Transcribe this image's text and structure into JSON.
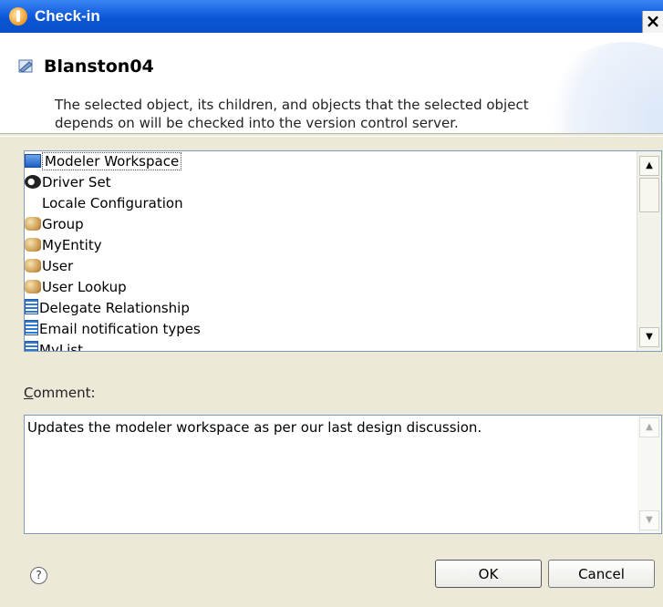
{
  "window": {
    "title": "Check-in",
    "close_label": "×"
  },
  "header": {
    "object_name": "Blanston04",
    "description_line1": "The selected object, its children, and objects that the selected object",
    "description_line2": "depends on will be checked into the version control server."
  },
  "list": {
    "items": [
      {
        "label": "Modeler Workspace",
        "icon": "workspace-icon"
      },
      {
        "label": "Driver Set",
        "icon": "driver-set-icon"
      },
      {
        "label": "Locale Configuration",
        "icon": "none"
      },
      {
        "label": "Group",
        "icon": "entity-icon"
      },
      {
        "label": "MyEntity",
        "icon": "entity-icon"
      },
      {
        "label": "User",
        "icon": "entity-icon"
      },
      {
        "label": "User Lookup",
        "icon": "entity-icon"
      },
      {
        "label": "Delegate Relationship",
        "icon": "list-icon"
      },
      {
        "label": "Email notification types",
        "icon": "list-icon"
      },
      {
        "label": "MyList",
        "icon": "list-icon"
      }
    ],
    "scroll_up": "▲",
    "scroll_down": "▼"
  },
  "comment": {
    "label_accel": "C",
    "label_rest": "omment:",
    "value": "Updates the modeler workspace as per our last design discussion."
  },
  "footer": {
    "help": "?",
    "ok": "OK",
    "cancel": "Cancel"
  }
}
